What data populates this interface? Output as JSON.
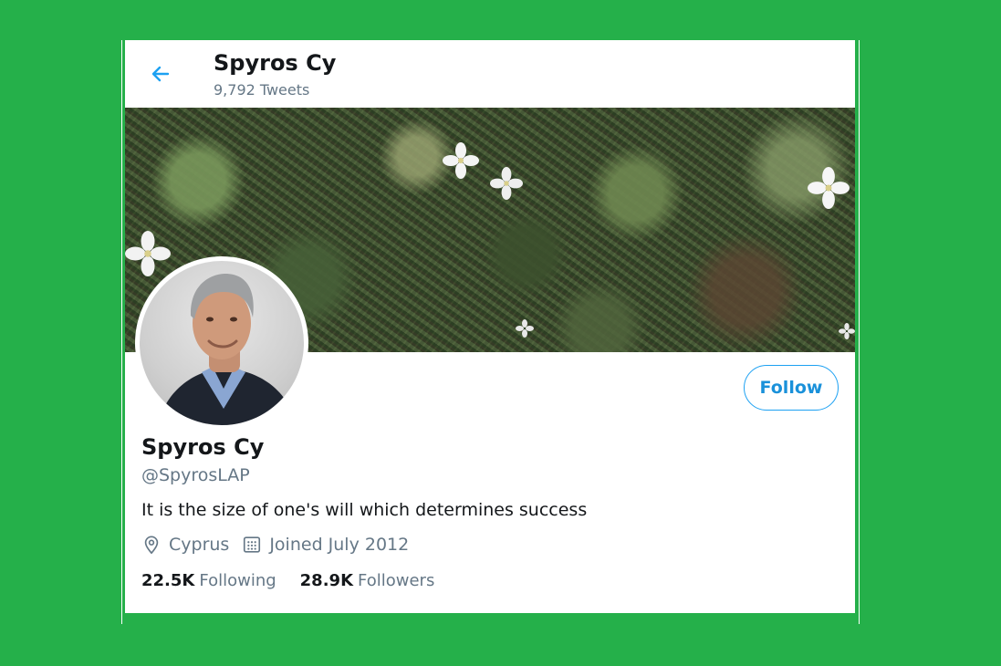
{
  "header": {
    "name": "Spyros Cy",
    "tweet_count": "9,792",
    "tweets_label": "Tweets"
  },
  "profile": {
    "name": "Spyros Cy",
    "handle": "@SpyrosLAP",
    "bio": "It is the size of one's will which determines success",
    "location": "Cyprus",
    "joined": "Joined July 2012",
    "following_count": "22.5K",
    "following_label": "Following",
    "followers_count": "28.9K",
    "followers_label": "Followers"
  },
  "actions": {
    "follow_label": "Follow"
  },
  "icons": {
    "back": "arrow-left-icon",
    "location": "location-pin-icon",
    "calendar": "calendar-icon"
  },
  "colors": {
    "background": "#25b04a",
    "accent": "#1da1f2",
    "text": "#14171a",
    "secondary_text": "#657786"
  }
}
